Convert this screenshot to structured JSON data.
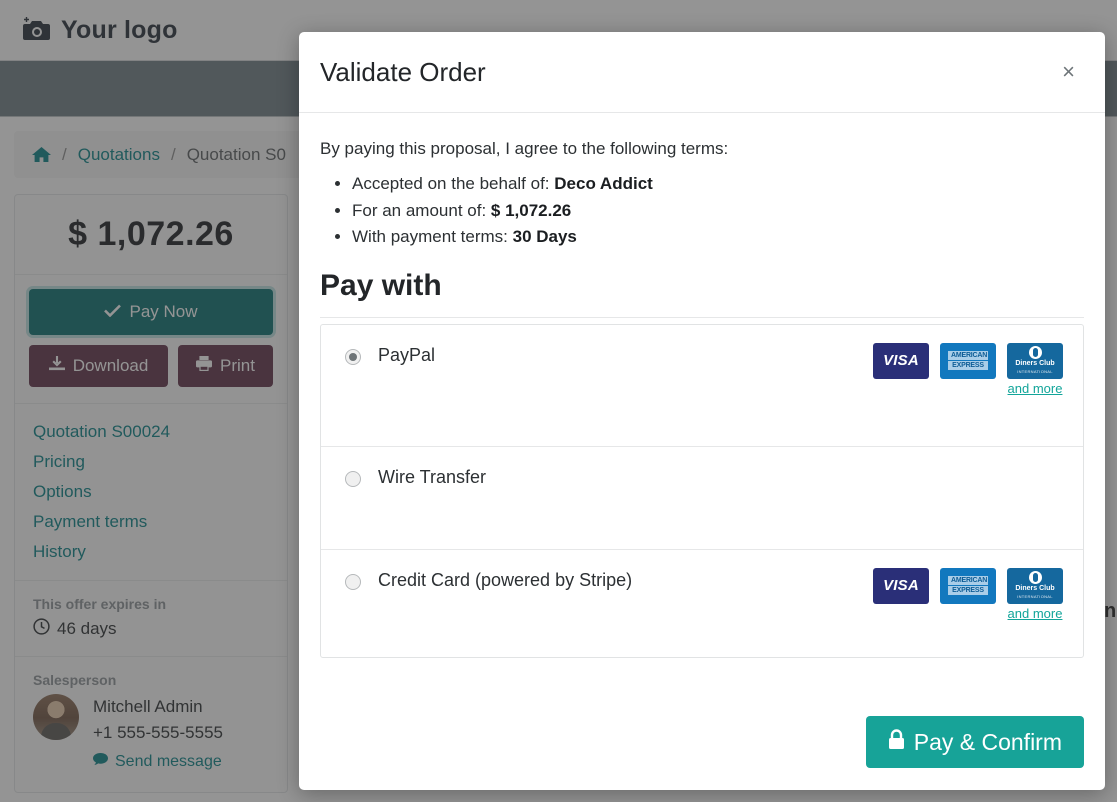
{
  "page": {
    "logo_text": "Your logo",
    "logo_icon": "camera-icon",
    "breadcrumb": {
      "home_icon": "home-icon",
      "sep": "/",
      "items": [
        "Quotations",
        "Quotation S0"
      ]
    },
    "sidebar": {
      "amount": "$ 1,072.26",
      "pay_now_label": "Pay Now",
      "pay_now_icon": "check-icon",
      "download_label": "Download",
      "download_icon": "download-icon",
      "print_label": "Print",
      "print_icon": "printer-icon",
      "links": [
        "Quotation S00024",
        "Pricing",
        "Options",
        "Payment terms",
        "History"
      ],
      "expires_title": "This offer expires in",
      "expires_value": "46 days",
      "expires_icon": "clock-icon",
      "salesperson_title": "Salesperson",
      "salesperson_name": "Mitchell Admin",
      "salesperson_phone": "+1 555-555-5555",
      "send_message_label": "Send message",
      "send_message_icon": "comment-icon"
    },
    "right_stub_text": "n"
  },
  "modal": {
    "title": "Validate Order",
    "close_icon": "close-icon",
    "close_label": "×",
    "lead": "By paying this proposal, I agree to the following terms:",
    "terms": [
      {
        "label": "Accepted on the behalf of: ",
        "value": "Deco Addict"
      },
      {
        "label": "For an amount of: ",
        "value": "$ 1,072.26"
      },
      {
        "label": "With payment terms: ",
        "value": "30 Days"
      }
    ],
    "pay_with_heading": "Pay with",
    "options": [
      {
        "id": "paypal",
        "label": "PayPal",
        "selected": true,
        "brands": [
          "visa",
          "amex",
          "diners"
        ],
        "and_more": "and more"
      },
      {
        "id": "wire-transfer",
        "label": "Wire Transfer",
        "selected": false,
        "brands": [],
        "and_more": ""
      },
      {
        "id": "credit-card",
        "label": "Credit Card (powered by Stripe)",
        "selected": false,
        "brands": [
          "visa",
          "amex",
          "diners"
        ],
        "and_more": "and more"
      }
    ],
    "brand_text": {
      "visa": "VISA",
      "amex_line1": "AMERICAN",
      "amex_line2": "EXPRESS",
      "diners_line1": "Diners Club",
      "diners_line2": "INTERNATIONAL"
    },
    "confirm_label": "Pay & Confirm",
    "confirm_icon": "lock-icon"
  },
  "colors": {
    "teal": "#017e84",
    "teal_button": "#016b6b",
    "maroon": "#5b2c44",
    "confirm_green": "#17a398",
    "navband": "#6b7a80",
    "and_more_green": "#12a59a"
  }
}
